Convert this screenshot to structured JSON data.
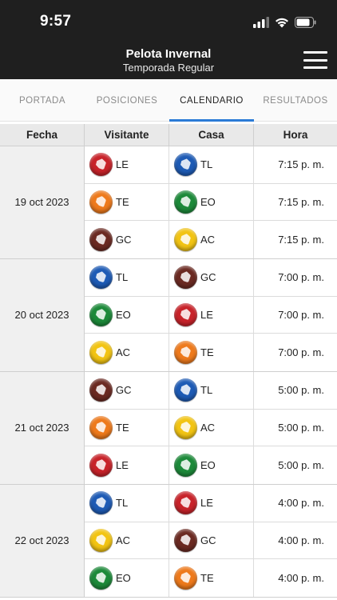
{
  "status_bar": {
    "time": "9:57"
  },
  "header": {
    "title": "Pelota Invernal",
    "subtitle": "Temporada Regular"
  },
  "tabs": [
    {
      "label": "PORTADA",
      "active": false
    },
    {
      "label": "POSICIONES",
      "active": false
    },
    {
      "label": "CALENDARIO",
      "active": true
    },
    {
      "label": "RESULTADOS",
      "active": false
    }
  ],
  "table": {
    "headers": [
      "Fecha",
      "Visitante",
      "Casa",
      "Hora"
    ],
    "groups": [
      {
        "date": "19 oct 2023",
        "games": [
          {
            "visitor": "LE",
            "home": "TL",
            "time": "7:15 p. m."
          },
          {
            "visitor": "TE",
            "home": "EO",
            "time": "7:15 p. m."
          },
          {
            "visitor": "GC",
            "home": "AC",
            "time": "7:15 p. m."
          }
        ]
      },
      {
        "date": "20 oct 2023",
        "games": [
          {
            "visitor": "TL",
            "home": "GC",
            "time": "7:00 p. m."
          },
          {
            "visitor": "EO",
            "home": "LE",
            "time": "7:00 p. m."
          },
          {
            "visitor": "AC",
            "home": "TE",
            "time": "7:00 p. m."
          }
        ]
      },
      {
        "date": "21 oct 2023",
        "games": [
          {
            "visitor": "GC",
            "home": "TL",
            "time": "5:00 p. m."
          },
          {
            "visitor": "TE",
            "home": "AC",
            "time": "5:00 p. m."
          },
          {
            "visitor": "LE",
            "home": "EO",
            "time": "5:00 p. m."
          }
        ]
      },
      {
        "date": "22 oct 2023",
        "games": [
          {
            "visitor": "TL",
            "home": "LE",
            "time": "4:00 p. m."
          },
          {
            "visitor": "AC",
            "home": "GC",
            "time": "4:00 p. m."
          },
          {
            "visitor": "EO",
            "home": "TE",
            "time": "4:00 p. m."
          }
        ]
      }
    ]
  },
  "team_colors": {
    "LE": "#c8232a",
    "TL": "#1e5bb5",
    "TE": "#ee7a1c",
    "EO": "#1d8a3a",
    "GC": "#6b2a22",
    "AC": "#f2c413"
  },
  "team_icons": {
    "LE": "eagle-logo-icon",
    "TL": "tiger-logo-icon",
    "TE": "fox-logo-icon",
    "EO": "serpent-logo-icon",
    "GC": "horse-logo-icon",
    "AC": "cougar-logo-icon"
  },
  "colors": {
    "header_bg": "#1f1f1f",
    "tab_accent": "#2b7bd6"
  }
}
